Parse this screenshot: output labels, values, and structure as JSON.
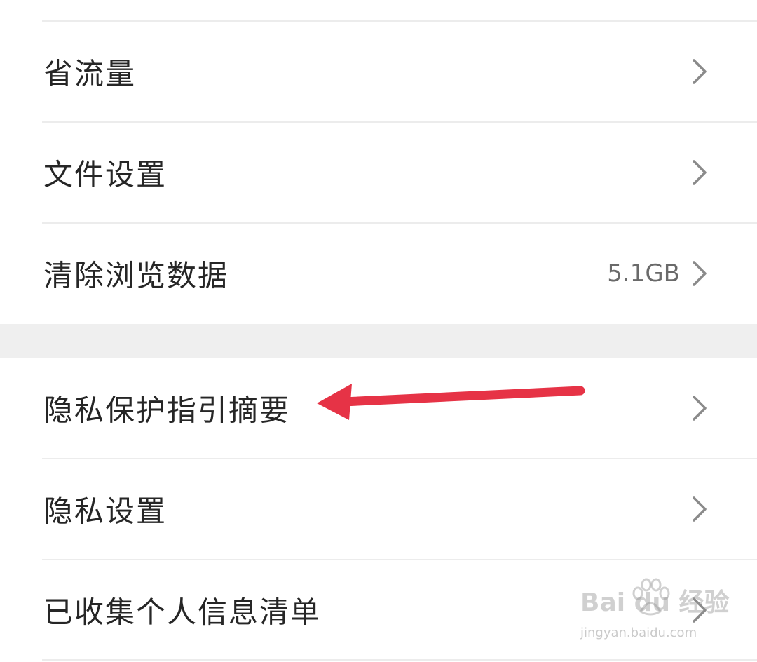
{
  "settings": {
    "group1": [
      {
        "label": "省流量",
        "value": ""
      },
      {
        "label": "文件设置",
        "value": ""
      },
      {
        "label": "清除浏览数据",
        "value": "5.1GB"
      }
    ],
    "group2": [
      {
        "label": "隐私保护指引摘要",
        "value": ""
      },
      {
        "label": "隐私设置",
        "value": ""
      },
      {
        "label": "已收集个人信息清单",
        "value": ""
      }
    ]
  },
  "icons": {
    "row_chevron": "chevron-right-icon",
    "annotation": "red-arrow-left-icon"
  },
  "colors": {
    "background": "#ffffff",
    "text": "#262626",
    "value_text": "#6a6a6a",
    "chevron": "#8a8a8a",
    "divider": "#ececec",
    "section_gap": "#efefef",
    "annotation_arrow": "#e63346"
  },
  "watermark": {
    "brand": "Bai du 经验",
    "url": "jingyan.baidu.com"
  }
}
